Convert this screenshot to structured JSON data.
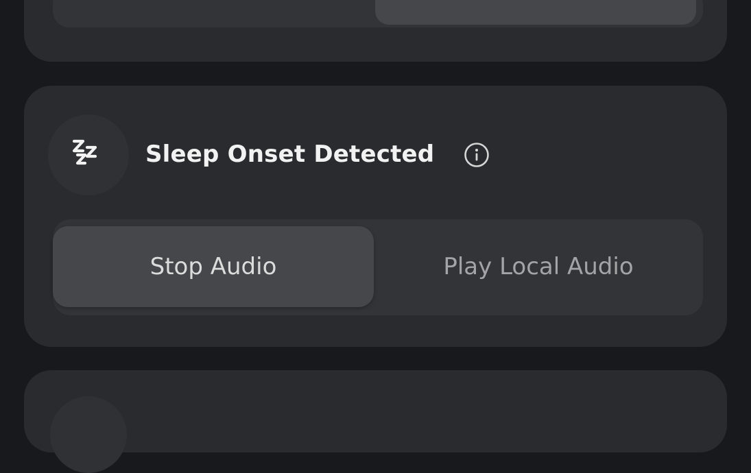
{
  "sleep_card": {
    "icon": "zzz-sleep-icon",
    "title": "Sleep Onset Detected",
    "info_icon": "info-circle-icon",
    "options": [
      {
        "label": "Stop Audio",
        "selected": true
      },
      {
        "label": "Play Local Audio",
        "selected": false
      }
    ]
  },
  "colors": {
    "background": "#17191c",
    "card": "#2a2b2f",
    "control_track": "#333438",
    "selected_option": "#46474b",
    "title_text": "#f2f2f2"
  }
}
